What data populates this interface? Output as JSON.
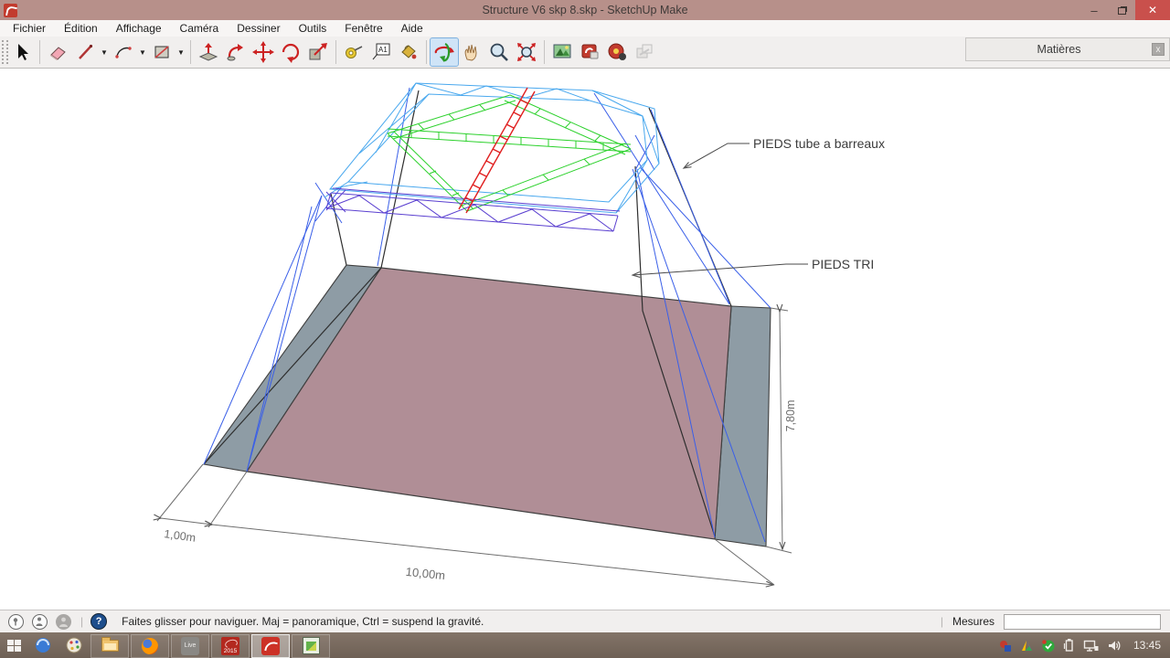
{
  "window": {
    "title": "Structure V6 skp 8.skp - SketchUp Make",
    "minimize_label": "–",
    "close_label": "✕"
  },
  "menu": {
    "items": [
      "Fichier",
      "Édition",
      "Affichage",
      "Caméra",
      "Dessiner",
      "Outils",
      "Fenêtre",
      "Aide"
    ]
  },
  "toolbar": {
    "text_tool_label": "A1"
  },
  "materials_panel": {
    "title": "Matières",
    "close_label": "x"
  },
  "viewport": {
    "annotation_tube": "PIEDS tube a barreaux",
    "annotation_tri": "PIEDS TRI",
    "dim_height": "7,80m",
    "dim_offset": "1,00m",
    "dim_width": "10,00m"
  },
  "statusbar": {
    "help_glyph": "?",
    "hint": "Faites glisser pour naviguer. Maj = panoramique, Ctrl =  suspend la gravité.",
    "measures_label": "Mesures",
    "measures_value": ""
  },
  "taskbar": {
    "live_label": "Live",
    "sw_label": "2015",
    "clock": "13:45"
  },
  "colors": {
    "titlebar": "#b7908a",
    "floor": "#b08e96",
    "side_panel": "#8e9ca5",
    "truss_cyan": "#49a8ee",
    "truss_green": "#2bd12b",
    "truss_red": "#e01f1f",
    "truss_purple": "#5a3fd0",
    "leg_blue": "#3a5fe8",
    "active_tool_bg": "#cfe4f7"
  }
}
